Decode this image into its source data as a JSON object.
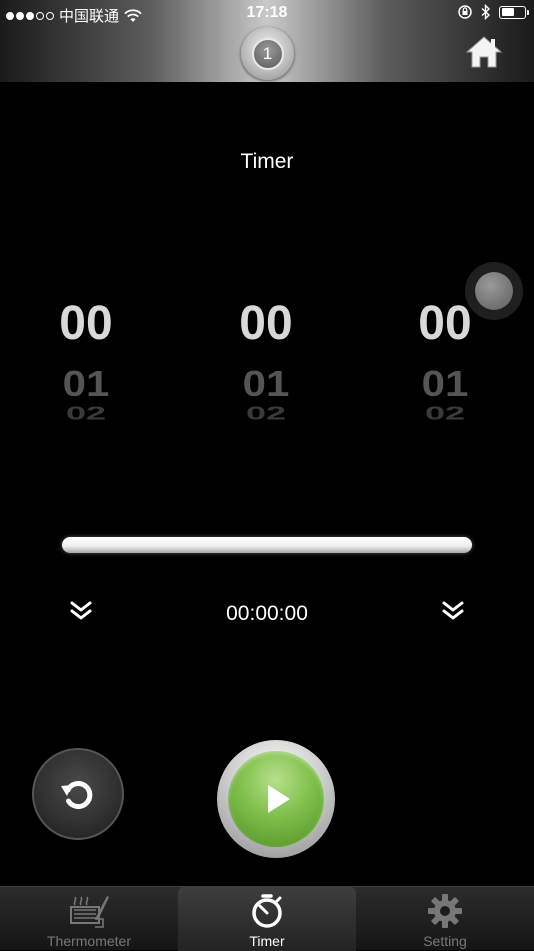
{
  "status_bar": {
    "carrier": "中国联通",
    "time": "17:18"
  },
  "header": {
    "channel_number": "1",
    "channel_icon": "dial-icon",
    "home_icon": "home-icon"
  },
  "main": {
    "title": "Timer",
    "wheels": [
      {
        "current": "00",
        "next": "01",
        "after": "02"
      },
      {
        "current": "00",
        "next": "01",
        "after": "02"
      },
      {
        "current": "00",
        "next": "01",
        "after": "02"
      }
    ],
    "progress": 0,
    "time_readout": "00:00:00",
    "left_arrow_icon": "chevron-double-down-icon",
    "right_arrow_icon": "chevron-double-down-icon",
    "reset_icon": "reset-icon",
    "play_icon": "play-icon"
  },
  "tabs": [
    {
      "label": "Thermometer",
      "icon": "thermometer-grill-icon",
      "active": false
    },
    {
      "label": "Timer",
      "icon": "stopwatch-icon",
      "active": true
    },
    {
      "label": "Setting",
      "icon": "gear-icon",
      "active": false
    }
  ],
  "colors": {
    "accent_green": "#7fbf4a",
    "background": "#000000"
  }
}
